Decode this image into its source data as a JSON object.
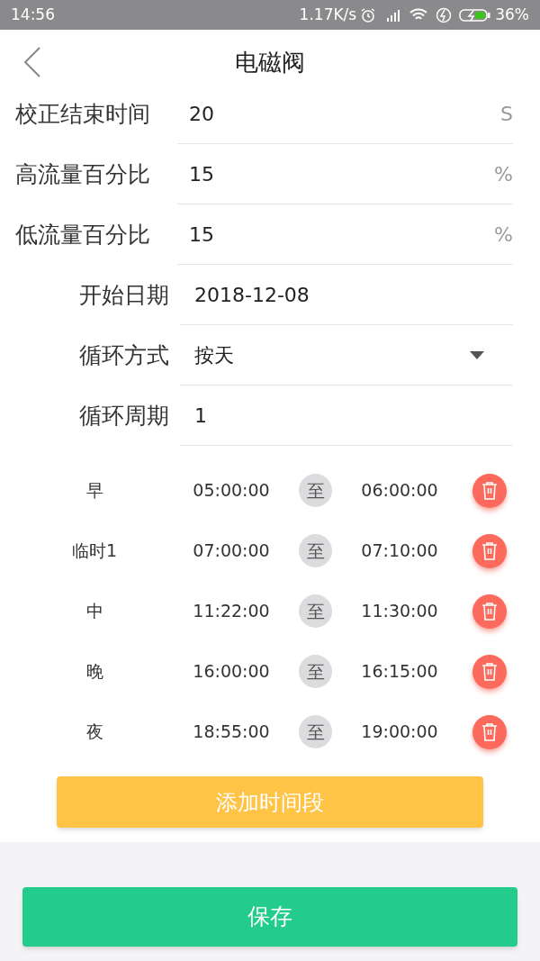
{
  "status_bar": {
    "time": "14:56",
    "speed": "1.17K/s",
    "battery": "36%"
  },
  "header": {
    "title": "电磁阀"
  },
  "fields": [
    {
      "label": "校正结束时间",
      "value": "20",
      "unit": "S",
      "kind": "text",
      "indent": false
    },
    {
      "label": "高流量百分比",
      "value": "15",
      "unit": "%",
      "kind": "text",
      "indent": false
    },
    {
      "label": "低流量百分比",
      "value": "15",
      "unit": "%",
      "kind": "text",
      "indent": false
    },
    {
      "label": "开始日期",
      "value": "2018-12-08",
      "kind": "text",
      "indent": true
    },
    {
      "label": "循环方式",
      "value": "按天",
      "kind": "select",
      "indent": true
    },
    {
      "label": "循环周期",
      "value": "1",
      "kind": "text",
      "indent": true
    }
  ],
  "periods": [
    {
      "name": "早",
      "start": "05:00:00",
      "sep": "至",
      "end": "06:00:00"
    },
    {
      "name": "临时1",
      "start": "07:00:00",
      "sep": "至",
      "end": "07:10:00"
    },
    {
      "name": "中",
      "start": "11:22:00",
      "sep": "至",
      "end": "11:30:00"
    },
    {
      "name": "晚",
      "start": "16:00:00",
      "sep": "至",
      "end": "16:15:00"
    },
    {
      "name": "夜",
      "start": "18:55:00",
      "sep": "至",
      "end": "19:00:00"
    }
  ],
  "add_button": "添加时间段",
  "save_button": "保存"
}
